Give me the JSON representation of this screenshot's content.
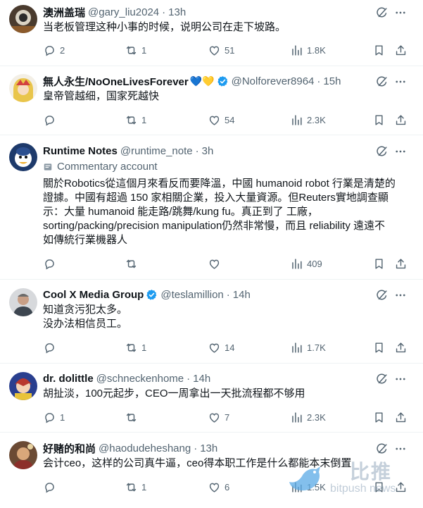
{
  "tweets": [
    {
      "name": "澳洲盖瑞",
      "handle": "@gary_liu2024",
      "time": "13h",
      "body": "当老板管理这种小事的时候，说明公司在走下坡路。",
      "replies": "2",
      "reposts": "1",
      "likes": "51",
      "views": "1.8K"
    },
    {
      "name": "無人永生/NoOneLivesForever",
      "name_emoji": "💙💛",
      "handle": "@Nolforever8964",
      "time": "15h",
      "body": "皇帝管越细，国家死越快",
      "replies": "",
      "reposts": "1",
      "likes": "54",
      "views": "2.3K"
    },
    {
      "name": "Runtime Notes",
      "handle": "@runtime_note",
      "time": "3h",
      "context": "Commentary account",
      "body_lines": [
        "關於Robotics從這個月來看反而要降溫，中國 humanoid robot 行業是清楚的",
        "證據。中國有超過 150 家相關企業，投入大量資源。但Reuters實地調查顯",
        "示：大量 humanoid 能走路/跳舞/kung fu。真正到了 工廠，",
        "sorting/packing/precision manipulation仍然非常慢，而且 reliability 遠遠不",
        "如傳統行業機器人"
      ],
      "replies": "",
      "reposts": "",
      "likes": "",
      "views": "409"
    },
    {
      "name": "Cool X Media Group",
      "handle": "@teslamillion",
      "time": "14h",
      "body_lines": [
        "知道贪污犯太多。",
        "没办法相信员工。"
      ],
      "replies": "",
      "reposts": "1",
      "likes": "14",
      "views": "1.7K"
    },
    {
      "name": "dr. dolittle",
      "handle": "@schneckenhome",
      "time": "14h",
      "body": "胡扯淡，100元起步，CEO一周拿出一天批流程都不够用",
      "replies": "1",
      "reposts": "",
      "likes": "7",
      "views": "2.3K"
    },
    {
      "name": "好赌的和尚",
      "handle": "@haodudeheshang",
      "time": "13h",
      "body": "会计ceo，这样的公司真牛逼，ceo得本职工作是什么都能本末倒置",
      "replies": "",
      "reposts": "1",
      "likes": "6",
      "views": "1.5K"
    }
  ],
  "watermark": {
    "cn": "比推",
    "en": "bitpush news"
  },
  "colors": {
    "text_primary": "#0f1419",
    "text_secondary": "#536471",
    "verified": "#1d9bf0",
    "divider": "#eff3f4"
  }
}
